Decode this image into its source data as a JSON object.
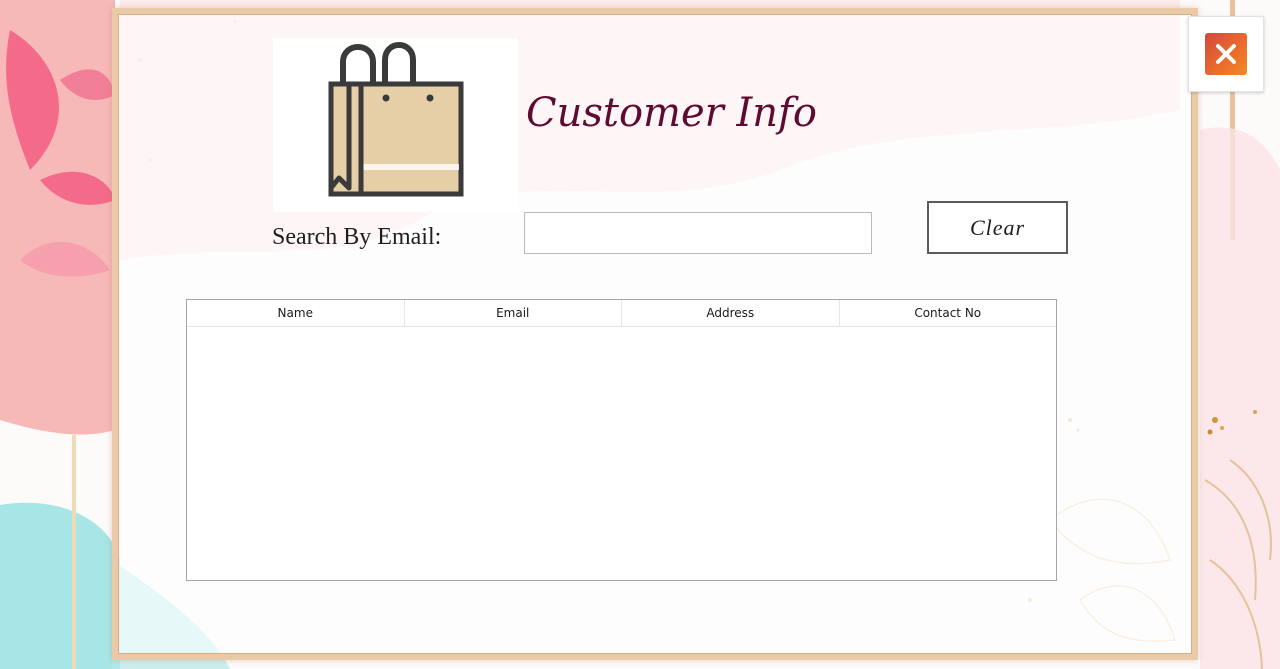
{
  "window": {
    "title": "Customer Info"
  },
  "search": {
    "label": "Search By Email:",
    "value": "",
    "placeholder": ""
  },
  "toolbar": {
    "clear_label": "Clear"
  },
  "table": {
    "columns": [
      "Name",
      "Email",
      "Address",
      "Contact No"
    ],
    "rows": []
  },
  "icons": {
    "logo": "shopping-bag-icon",
    "close": "close-icon"
  },
  "colors": {
    "title": "#5e0b32",
    "frame": "#e9c9a6",
    "close_accent": "#ea6a2c",
    "bag_fill": "#e6cfa6",
    "bag_stroke": "#3a3a3a"
  }
}
